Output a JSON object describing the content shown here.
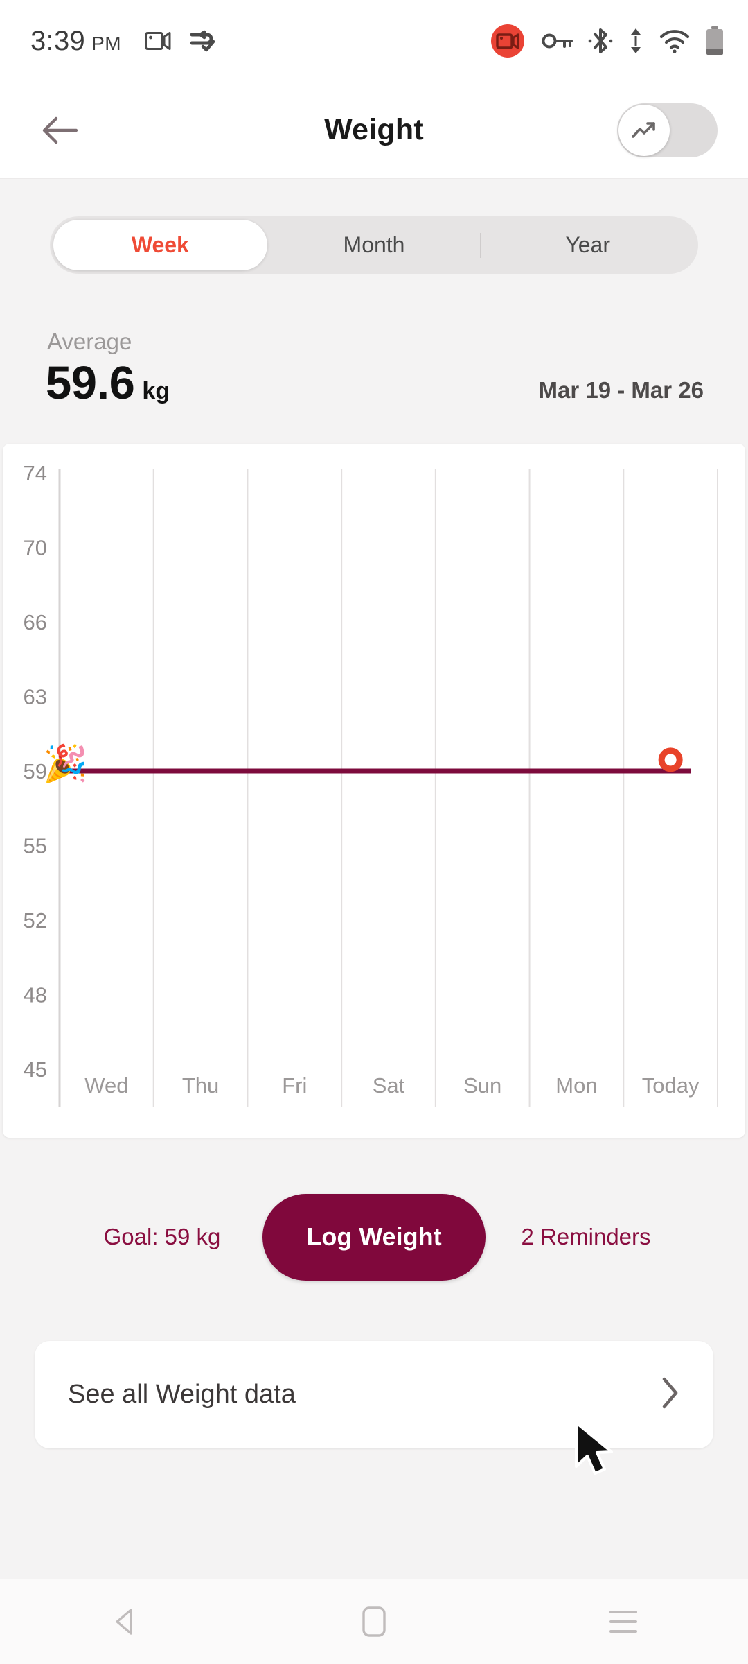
{
  "status_bar": {
    "time": "3:39",
    "ampm": "PM",
    "left_icons": [
      {
        "name": "screen-record-icon"
      },
      {
        "name": "data-saver-check-icon"
      }
    ],
    "right_icons": [
      {
        "name": "recording-badge-icon",
        "color": "#ea4335"
      },
      {
        "name": "vpn-key-icon"
      },
      {
        "name": "bluetooth-icon"
      },
      {
        "name": "data-transfer-icon"
      },
      {
        "name": "wifi-icon"
      },
      {
        "name": "battery-icon"
      }
    ]
  },
  "app_bar": {
    "back_icon": "arrow-left-icon",
    "title": "Weight",
    "toggle": {
      "name": "trend-toggle",
      "state": "off",
      "icon": "trending-up-icon"
    }
  },
  "tabs": [
    {
      "label": "Week",
      "active": true
    },
    {
      "label": "Month",
      "active": false
    },
    {
      "label": "Year",
      "active": false
    }
  ],
  "summary": {
    "average_label": "Average",
    "average_value": "59.6",
    "average_unit": "kg",
    "date_range": "Mar 19 - Mar 26"
  },
  "chart_data": {
    "type": "line",
    "title": "",
    "xlabel": "",
    "ylabel": "",
    "categories": [
      "Wed",
      "Thu",
      "Fri",
      "Sat",
      "Sun",
      "Mon",
      "Today"
    ],
    "ytick_labels": [
      "74",
      "70",
      "66",
      "63",
      "59",
      "55",
      "52",
      "48",
      "45"
    ],
    "ytick_values": [
      74,
      70,
      66,
      63,
      59,
      55,
      52,
      48,
      45
    ],
    "ylim": [
      45,
      74
    ],
    "grid": "vertical",
    "legend": "none",
    "series": [
      {
        "name": "Weight",
        "values": [
          null,
          null,
          null,
          null,
          null,
          null,
          59.6
        ],
        "point_style": "hollow-circle",
        "color": "#e8432a"
      }
    ],
    "goal_line": {
      "label": "Goal",
      "value": 59,
      "color": "#7d0b3c",
      "marker_emoji": "🎉"
    }
  },
  "actions": {
    "goal_text": "Goal: 59 kg",
    "log_button": "Log Weight",
    "reminders_text": "2 Reminders"
  },
  "see_all": {
    "label": "See all Weight data",
    "chevron_icon": "chevron-right-icon"
  },
  "nav_bar": [
    {
      "name": "nav-back-icon"
    },
    {
      "name": "nav-home-icon"
    },
    {
      "name": "nav-recents-icon"
    }
  ],
  "colors": {
    "accent_red": "#ef4b36",
    "brand_maroon": "#80083c",
    "page_bg": "#f4f3f3"
  }
}
